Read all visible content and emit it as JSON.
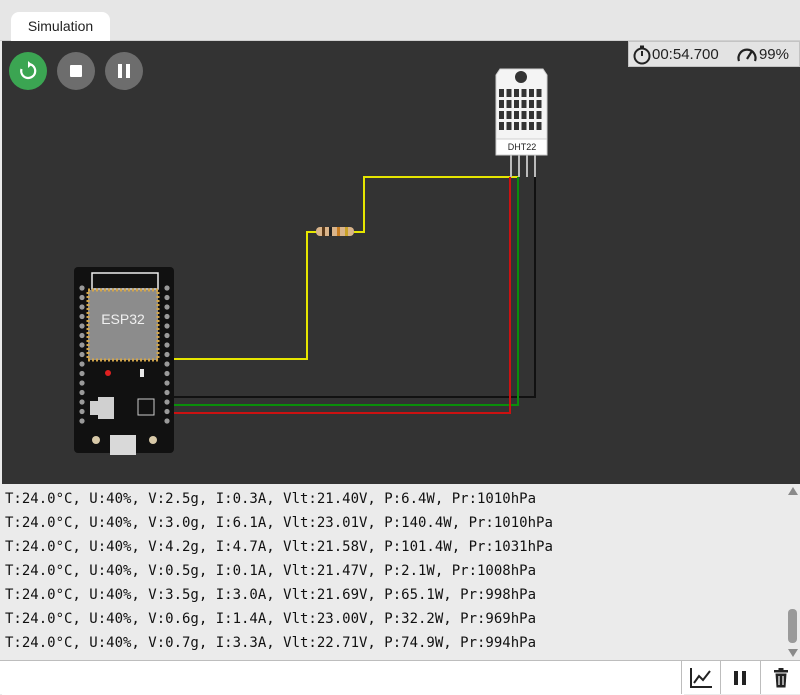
{
  "tab": {
    "label": "Simulation"
  },
  "status": {
    "timer": "00:54.700",
    "speed": "99%"
  },
  "icons": {
    "restart": "restart-icon",
    "stop": "stop-icon",
    "pause": "pause-icon",
    "timer": "stopwatch-icon",
    "speed": "speedometer-icon",
    "plot": "line-chart-icon",
    "console_pause": "pause-icon",
    "clear": "trash-icon"
  },
  "components": {
    "esp32": {
      "label": "ESP32"
    },
    "sensor": {
      "label": "DHT22"
    }
  },
  "wire_colors": {
    "data": "#e6e600",
    "vcc": "#cc1111",
    "gnd": "#111111",
    "green": "#0a8f0a"
  },
  "console": {
    "lines": [
      "T:24.0°C, U:40%, V:2.5g, I:0.3A, Vlt:21.40V, P:6.4W, Pr:1010hPa",
      "T:24.0°C, U:40%, V:3.0g, I:6.1A, Vlt:23.01V, P:140.4W, Pr:1010hPa",
      "T:24.0°C, U:40%, V:4.2g, I:4.7A, Vlt:21.58V, P:101.4W, Pr:1031hPa",
      "T:24.0°C, U:40%, V:0.5g, I:0.1A, Vlt:21.47V, P:2.1W, Pr:1008hPa",
      "T:24.0°C, U:40%, V:3.5g, I:3.0A, Vlt:21.69V, P:65.1W, Pr:998hPa",
      "T:24.0°C, U:40%, V:0.6g, I:1.4A, Vlt:23.00V, P:32.2W, Pr:969hPa",
      "T:24.0°C, U:40%, V:0.7g, I:3.3A, Vlt:22.71V, P:74.9W, Pr:994hPa"
    ],
    "input_value": ""
  }
}
